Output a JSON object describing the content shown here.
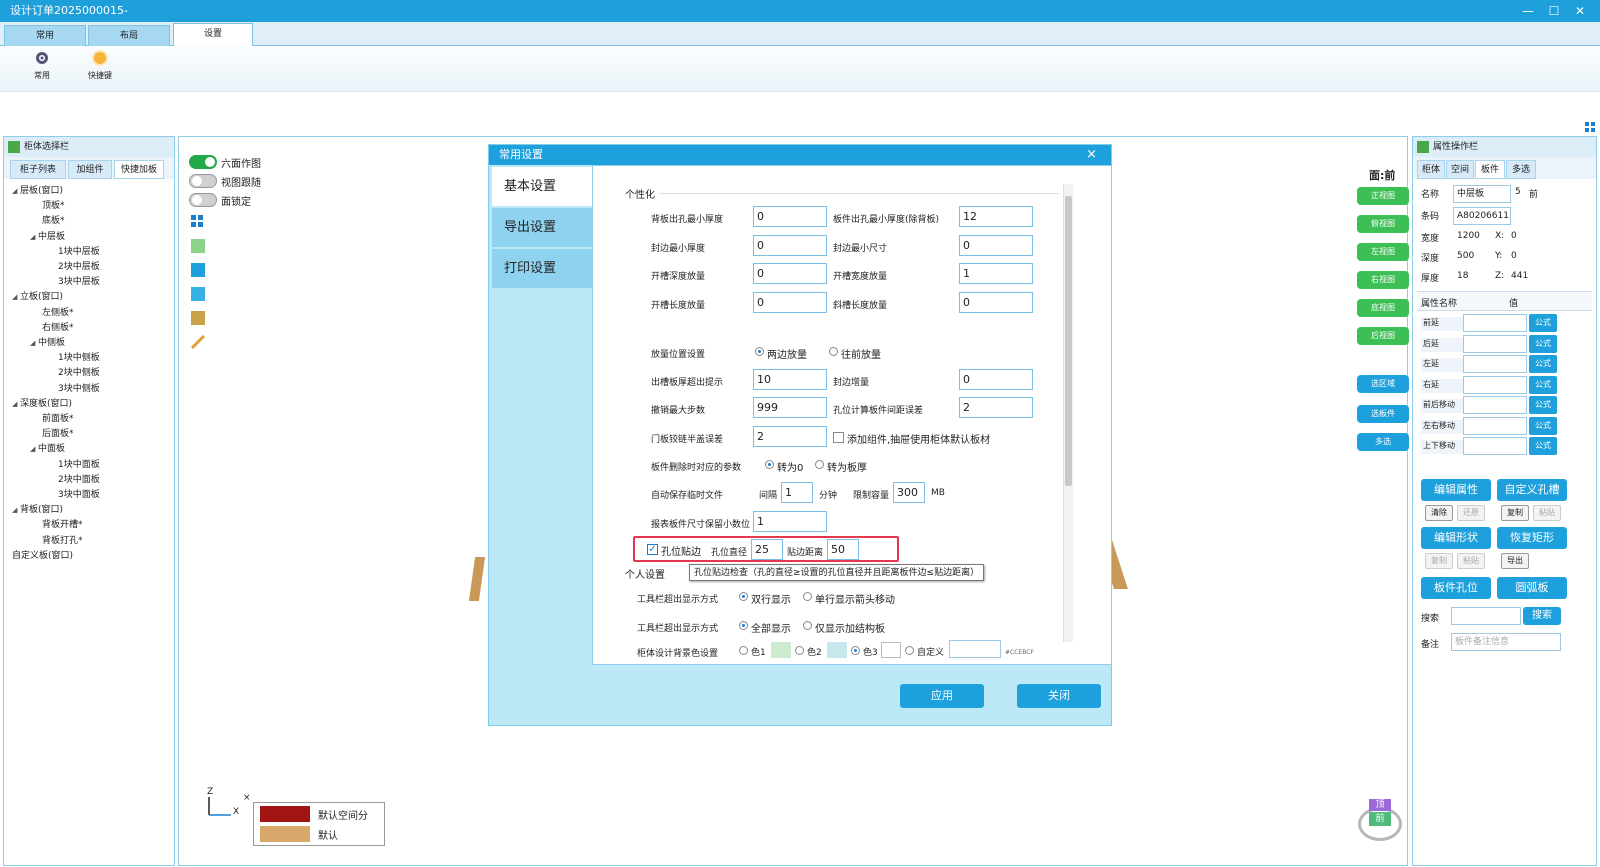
{
  "window": {
    "title": "设计订单2025000015-",
    "controls": [
      "—",
      "☐",
      "✕"
    ]
  },
  "main_tabs": [
    {
      "label": "常用"
    },
    {
      "label": "布局"
    },
    {
      "label": "设置"
    }
  ],
  "ribbon": {
    "buttons": [
      {
        "label": "常用",
        "icon": "gear-icon"
      },
      {
        "label": "快捷键",
        "icon": "shortcut-icon"
      }
    ]
  },
  "left_panel": {
    "title": "柜体选择栏",
    "tabs": [
      "柜子列表",
      "加组件",
      "快捷加板"
    ],
    "tree": [
      {
        "label": "层板(窗口)",
        "level": 0,
        "expand": true
      },
      {
        "label": "顶板*",
        "level": 1
      },
      {
        "label": "底板*",
        "level": 1
      },
      {
        "label": "中层板",
        "level": 1,
        "expand": true
      },
      {
        "label": "1块中层板",
        "level": 2
      },
      {
        "label": "2块中层板",
        "level": 2
      },
      {
        "label": "3块中层板",
        "level": 2
      },
      {
        "label": "立板(窗口)",
        "level": 0,
        "expand": true
      },
      {
        "label": "左侧板*",
        "level": 1
      },
      {
        "label": "右侧板*",
        "level": 1
      },
      {
        "label": "中侧板",
        "level": 1,
        "expand": true
      },
      {
        "label": "1块中侧板",
        "level": 2
      },
      {
        "label": "2块中侧板",
        "level": 2
      },
      {
        "label": "3块中侧板",
        "level": 2
      },
      {
        "label": "深度板(窗口)",
        "level": 0,
        "expand": true
      },
      {
        "label": "前面板*",
        "level": 1
      },
      {
        "label": "后面板*",
        "level": 1
      },
      {
        "label": "中面板",
        "level": 1,
        "expand": true
      },
      {
        "label": "1块中面板",
        "level": 2
      },
      {
        "label": "2块中面板",
        "level": 2
      },
      {
        "label": "3块中面板",
        "level": 2
      },
      {
        "label": "背板(窗口)",
        "level": 0,
        "expand": true
      },
      {
        "label": "背板开槽*",
        "level": 1
      },
      {
        "label": "背板打孔*",
        "level": 1
      },
      {
        "label": "自定义板(窗口)",
        "level": 0
      }
    ]
  },
  "viewport": {
    "toggles": [
      {
        "label": "六面作图",
        "on": true
      },
      {
        "label": "视图跟随",
        "on": false
      },
      {
        "label": "面锁定",
        "on": false
      }
    ],
    "face_label": "面:前",
    "view_buttons": [
      "正视图",
      "俯视图",
      "左视图",
      "右视图",
      "底视图",
      "后视图"
    ],
    "select_buttons": [
      "选区域",
      "选板件",
      "多选"
    ],
    "axis": {
      "z": "Z",
      "x": "X",
      "cross": "×"
    },
    "legend": [
      {
        "label": "默认空间分",
        "color": "#a31515"
      },
      {
        "label": "默认",
        "color": "#d8a96a"
      }
    ],
    "cube": {
      "top": "顶",
      "front": "前"
    }
  },
  "right_panel": {
    "title": "属性操作栏",
    "tabs": [
      "柜体",
      "空间",
      "板件",
      "多选"
    ],
    "props": {
      "name_label": "名称",
      "name_value": "中层板",
      "count": "5",
      "face": "前",
      "code_label": "条码",
      "code_value": "A80206611",
      "width_label": "宽度",
      "width_value": "1200",
      "x_label": "X:",
      "x_value": "0",
      "depth_label": "深度",
      "depth_value": "500",
      "y_label": "Y:",
      "y_value": "0",
      "thick_label": "厚度",
      "thick_value": "18",
      "z_label": "Z:",
      "z_value": "441"
    },
    "attr_header": {
      "name": "属性名称",
      "value": "值"
    },
    "attrs": [
      "前延",
      "后延",
      "左延",
      "右延",
      "前后移动",
      "左右移动",
      "上下移动"
    ],
    "formula_label": "公式",
    "big_buttons": [
      "编辑属性",
      "自定义孔槽",
      "编辑形状",
      "恢复矩形",
      "板件孔位",
      "圆弧板"
    ],
    "small_row1": [
      "清除",
      "还原",
      "复制",
      "粘贴"
    ],
    "small_row2": [
      "复制",
      "粘贴",
      "导出"
    ],
    "search_label": "搜索",
    "search_button": "搜索",
    "note_label": "备注",
    "note_placeholder": "板件备注信息"
  },
  "dialog": {
    "title": "常用设置",
    "close": "×",
    "nav": [
      "基本设置",
      "导出设置",
      "打印设置"
    ],
    "section_personal": "个性化",
    "rows": [
      {
        "l1": "背板出孔最小厚度",
        "v1": "0",
        "l2": "板件出孔最小厚度(除背板)",
        "v2": "12"
      },
      {
        "l1": "封边最小厚度",
        "v1": "0",
        "l2": "封边最小尺寸",
        "v2": "0"
      },
      {
        "l1": "开槽深度放量",
        "v1": "0",
        "l2": "开槽宽度放量",
        "v2": "1"
      },
      {
        "l1": "开槽长度放量",
        "v1": "0",
        "l2": "斜槽长度放量",
        "v2": "0"
      }
    ],
    "place_label": "放量位置设置",
    "place_opt1": "两边放量",
    "place_opt2": "往前放量",
    "slot_label": "出槽板厚超出提示",
    "slot_value": "10",
    "edge_add_label": "封边增量",
    "edge_add_value": "0",
    "undo_label": "撤销最大步数",
    "undo_value": "999",
    "hole_err_label": "孔位计算板件间距误差",
    "hole_err_value": "2",
    "door_label": "门板铰链半盖误差",
    "door_value": "2",
    "add_comp_label": "添加组件,抽屉使用柜体默认板材",
    "del_label": "板件删除时对应的参数",
    "del_opt1": "转为0",
    "del_opt2": "转为板厚",
    "autosave_label": "自动保存临时文件",
    "interval_label": "间隔",
    "interval_value": "1",
    "minute": "分钟",
    "limit_label": "限制容量",
    "limit_value": "300",
    "mb": "MB",
    "decimal_label": "报表板件尺寸保留小数位",
    "decimal_value": "1",
    "hole_edge_label": "孔位贴边",
    "hole_dia_label": "孔位直径",
    "hole_dia_value": "25",
    "edge_dist_label": "贴边距离",
    "edge_dist_value": "50",
    "tooltip": "孔位贴边检查（孔的直径≥设置的孔位直径并且距离板件边≤贴边距离）",
    "section_user": "个人设置",
    "tb1_label": "工具栏超出显示方式",
    "tb1_opt1": "双行显示",
    "tb1_opt2": "单行显示箭头移动",
    "tb2_label": "工具栏超出显示方式",
    "tb2_opt1": "全部显示",
    "tb2_opt2": "仅显示加结构板",
    "bg_label": "柜体设计背景色设置",
    "bg_c1": "色1",
    "bg_c2": "色2",
    "bg_c3": "色3",
    "bg_custom": "自定义",
    "bg_hex": "#CCEBCF",
    "apply": "应用",
    "close_btn": "关闭"
  }
}
